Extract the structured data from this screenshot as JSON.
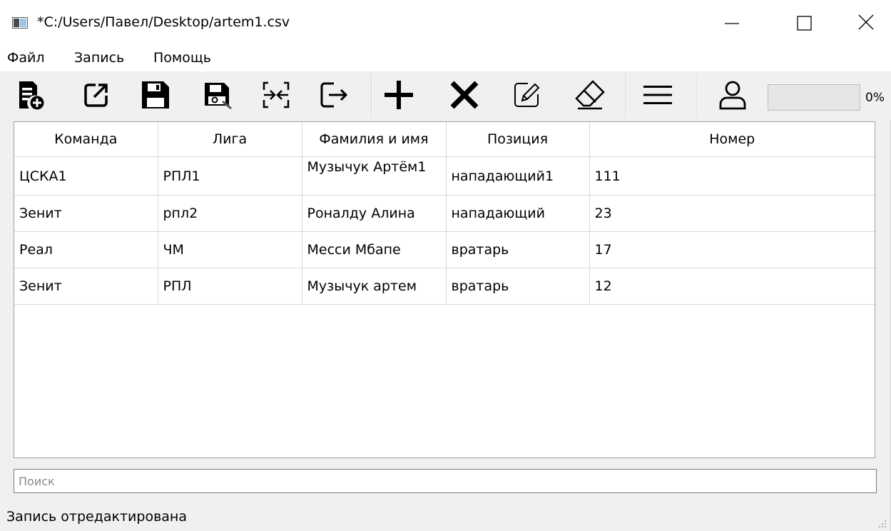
{
  "window": {
    "title": "*C:/Users/Павел/Desktop/artem1.csv"
  },
  "menu": {
    "items": [
      "Файл",
      "Запись",
      "Помощь"
    ]
  },
  "toolbar": {
    "icons": [
      "new-file-icon",
      "open-external-icon",
      "save-icon",
      "save-as-icon",
      "convert-icon",
      "exit-icon",
      "add-icon",
      "delete-icon",
      "edit-icon",
      "eraser-icon",
      "menu-icon",
      "user-icon"
    ],
    "progress_percent": 0,
    "progress_label": "0%"
  },
  "table": {
    "columns": [
      "Команда",
      "Лига",
      "Фамилия и имя",
      "Позиция",
      "Номер"
    ],
    "rows": [
      [
        "ЦСКА1",
        "РПЛ1",
        "Музычук Артём1",
        "нападающий1",
        "111"
      ],
      [
        "Зенит",
        "рпл2",
        "Роналду Алина",
        "нападающий",
        "23"
      ],
      [
        "Реал",
        "ЧМ",
        "Месси Мбапе",
        "вратарь",
        "17"
      ],
      [
        "Зенит",
        "РПЛ",
        "Музычук артем",
        "вратарь",
        "12"
      ]
    ]
  },
  "search": {
    "placeholder": "Поиск",
    "value": ""
  },
  "status": {
    "text": "Запись отредактирована"
  },
  "colors": {
    "progress_fill": "#06b025",
    "border": "#a0a0a0"
  }
}
